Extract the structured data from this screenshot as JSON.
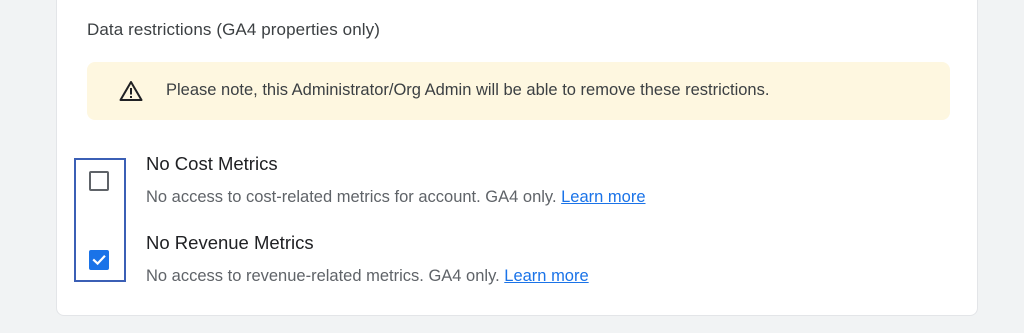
{
  "section": {
    "title": "Data restrictions (GA4 properties only)"
  },
  "notice": {
    "icon": "warning-triangle-icon",
    "text": "Please note, this Administrator/Org Admin will be able to remove these restrictions.",
    "background_color": "#fef7e0"
  },
  "options": [
    {
      "title": "No Cost Metrics",
      "description": "No access to cost-related metrics for account. GA4 only.",
      "link_label": "Learn more",
      "checked": false
    },
    {
      "title": "No Revenue Metrics",
      "description": "No access to revenue-related metrics. GA4 only.",
      "link_label": "Learn more",
      "checked": true
    }
  ],
  "colors": {
    "accent": "#1a73e8",
    "highlight_border": "#3b5fb5",
    "text_primary": "#202124",
    "text_secondary": "#5f6368"
  }
}
